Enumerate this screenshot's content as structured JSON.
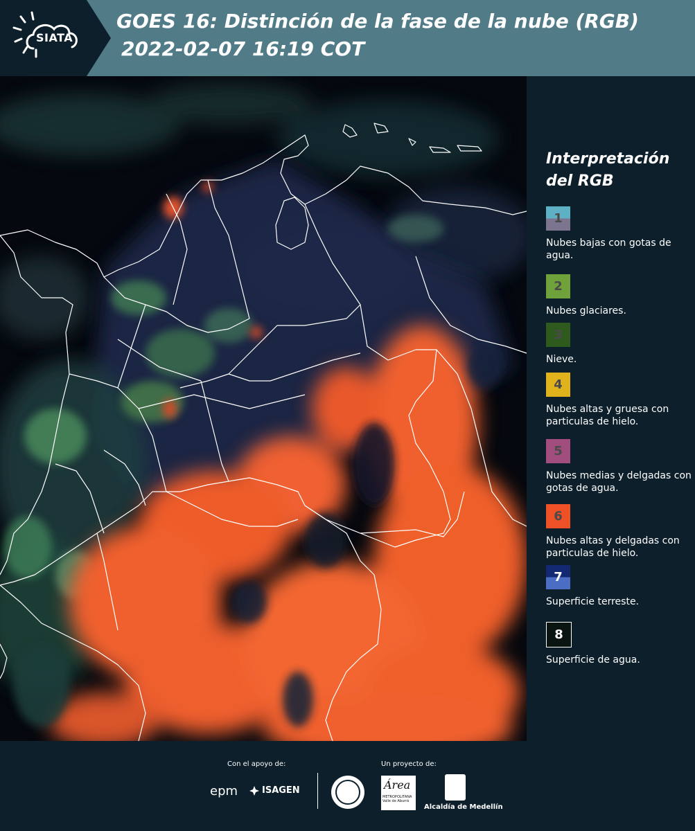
{
  "header": {
    "logo_text": "SIATA",
    "title_line1": "GOES 16: Distinción de la fase de la nube (RGB)",
    "title_line2": "2022-02-07 16:19 COT",
    "background": "#527b88"
  },
  "legend": {
    "title": "Interpretación del RGB",
    "items": [
      {
        "number": "1",
        "description": "Nubes bajas con gotas de agua.",
        "color_top": "#5eb0c4",
        "color_bottom": "#7d7590"
      },
      {
        "number": "2",
        "description": "Nubes glaciares.",
        "color_top": "#6fa23a",
        "color_bottom": "#6fa23a"
      },
      {
        "number": "3",
        "description": "Nieve.",
        "color_top": "#2f5a1d",
        "color_bottom": "#2f5a1d"
      },
      {
        "number": "4",
        "description": "Nubes altas y gruesa con particulas de hielo.",
        "color_top": "#e0b21c",
        "color_bottom": "#e0b21c"
      },
      {
        "number": "5",
        "description": "Nubes medias y delgadas con gotas de agua.",
        "color_top": "#a14e7e",
        "color_bottom": "#a14e7e"
      },
      {
        "number": "6",
        "description": "Nubes altas y delgadas con particulas de hielo.",
        "color_top": "#ef5126",
        "color_bottom": "#ef5126"
      },
      {
        "number": "7",
        "description": "Superficie terreste.",
        "color_top": "#122872",
        "color_bottom": "#4b6ec4"
      },
      {
        "number": "8",
        "description": "Superficie de agua.",
        "color_top": "#0a1410",
        "color_bottom": "#0a1410"
      }
    ]
  },
  "footer": {
    "support_label": "Con el apoyo de:",
    "project_label": "Un proyecto de:",
    "sponsors": [
      "epm",
      "ISAGEN"
    ],
    "amva_name": "Área",
    "amva_sub": "METROPOLITANA Valle de Aburrá",
    "medellin_label": "Alcaldía de Medellín"
  },
  "colors": {
    "panel": "#0c1f2b",
    "cloud_ice": "#ff6b36",
    "borders": "#ffffff"
  }
}
